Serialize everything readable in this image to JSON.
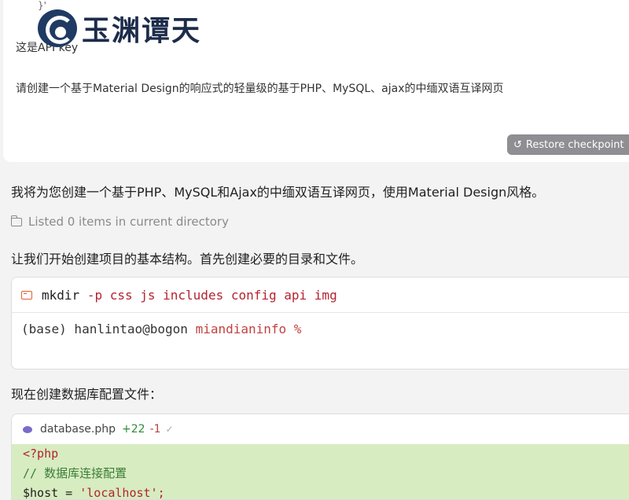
{
  "watermark": {
    "text": "玉渊谭天"
  },
  "user_message": {
    "corner_fragment": "}'",
    "apikey_line": "这是API key",
    "request_line": "请创建一个基于Material Design的响应式的轻量级的基于PHP、MySQL、ajax的中缅双语互译网页",
    "restore_button": "Restore checkpoint"
  },
  "assistant": {
    "intro": "我将为您创建一个基于PHP、MySQL和Ajax的中缅双语互译网页，使用Material Design风格。",
    "listed": "Listed 0 items in current directory",
    "start_text": "让我们开始创建项目的基本结构。首先创建必要的目录和文件。",
    "terminal": {
      "command_name": "mkdir",
      "command_args": "-p css js includes config api img",
      "output_user": "(base) hanlintao@bogon",
      "output_dir": "miandianinfo %"
    },
    "db_config_text": "现在创建数据库配置文件：",
    "code_file": {
      "filename": "database.php",
      "added": "+22",
      "removed": "-1",
      "lines": {
        "l1": "<?php",
        "l2": "// 数据库连接配置",
        "l3_var": "$host = ",
        "l3_str": "'localhost';"
      }
    }
  },
  "colors": {
    "added_bg": "#d7ecc0",
    "restore_bg": "#8e8e93",
    "command_args": "#b4232f"
  },
  "icons": [
    "folder-icon",
    "terminal-icon",
    "restore-icon",
    "php-file-icon",
    "check-icon"
  ]
}
